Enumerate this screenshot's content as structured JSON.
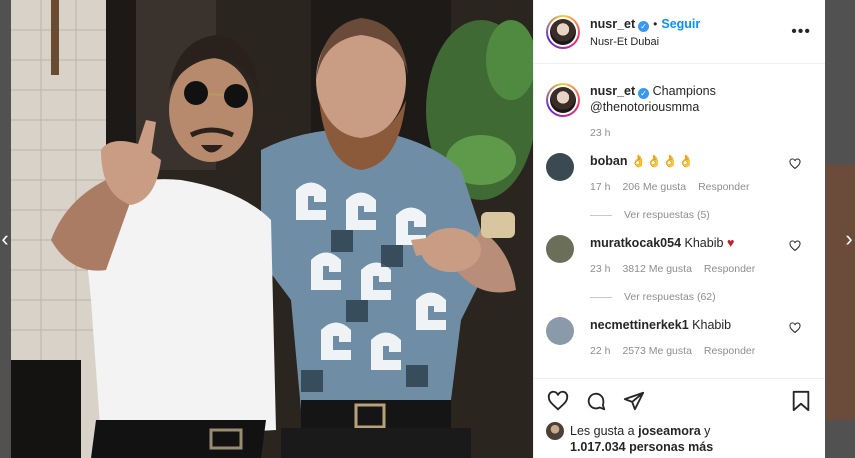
{
  "post": {
    "username": "nusr_et",
    "follow_label": "Seguir",
    "separator": "•",
    "location": "Nusr-Et Dubai",
    "more_icon": "more-options-icon",
    "caption": {
      "username": "nusr_et",
      "text_line1": "Champions",
      "text_line2": "@thenotoriousmma",
      "time": "23 h"
    }
  },
  "comments": [
    {
      "username": "boban",
      "text": "👌👌👌👌",
      "time": "17 h",
      "likes": "206 Me gusta",
      "reply": "Responder",
      "view_replies": "Ver respuestas (5)",
      "avatar_color": "#3b4a52"
    },
    {
      "username": "muratkocak054",
      "text": "Khabib",
      "heart": "♥",
      "time": "23 h",
      "likes": "3812 Me gusta",
      "reply": "Responder",
      "view_replies": "Ver respuestas (62)",
      "avatar_color": "#6b6f5a"
    },
    {
      "username": "necmettinerkek1",
      "text": "Khabib",
      "time": "22 h",
      "likes": "2573 Me gusta",
      "reply": "Responder",
      "avatar_color": "#8a9aa8"
    }
  ],
  "actions": {
    "like_icon": "heart-outline-icon",
    "comment_icon": "comment-icon",
    "share_icon": "share-icon",
    "save_icon": "bookmark-icon"
  },
  "likes": {
    "prefix": "Les gusta a",
    "user": "joseamora",
    "suffix": "y",
    "count_line": "1.017.034 personas más"
  },
  "navigation": {
    "prev_icon": "chevron-left-icon",
    "next_icon": "chevron-right-icon",
    "prev_glyph": "‹",
    "next_glyph": "›"
  },
  "colors": {
    "accent": "#0095f6",
    "verified": "#3897f0",
    "text": "#262626",
    "muted": "#8e8e8e"
  }
}
